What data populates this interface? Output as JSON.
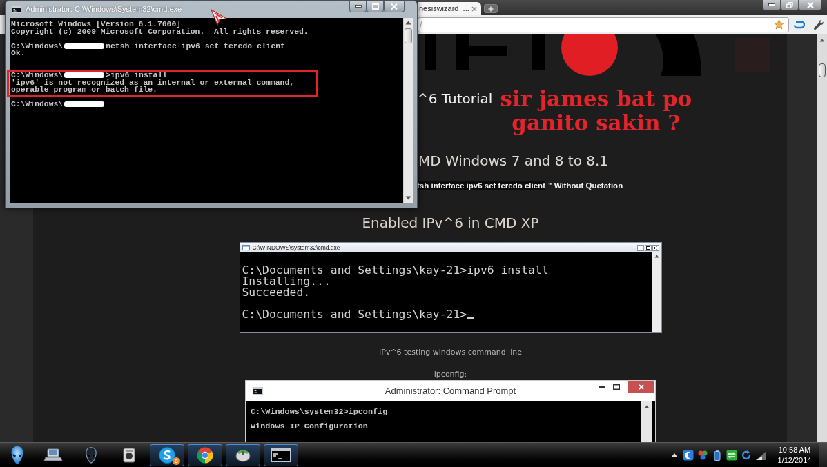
{
  "cmd_window": {
    "title": "Administrator: C:\\Windows\\System32\\cmd.exe",
    "blocks": [
      {
        "highlighted": false,
        "lines": [
          {
            "text": "Microsoft Windows [Version 6.1.7600]",
            "redacted": false
          },
          {
            "text": "Copyright (c) 2009 Microsoft Corporation.  All rights reserved.",
            "redacted": false
          }
        ]
      },
      {
        "highlighted": false,
        "lines": [
          {
            "prefix": "C:\\Windows\\",
            "redacted": true,
            "text": "netsh interface ipv6 set teredo client"
          },
          {
            "text": "Ok.",
            "redacted": false
          }
        ]
      },
      {
        "highlighted": true,
        "lines": [
          {
            "prefix": "C:\\Windows\\",
            "redacted": true,
            "text": ">ipv6 install"
          },
          {
            "text": "'ipv6' is not recognized as an internal or external command,",
            "redacted": false
          },
          {
            "text": "operable program or batch file.",
            "redacted": false
          }
        ]
      },
      {
        "highlighted": false,
        "lines": [
          {
            "prefix": "C:\\Windows\\",
            "redacted": true
          }
        ]
      }
    ]
  },
  "browser": {
    "tab": {
      "title": "nesiswizard_...",
      "selected": true
    },
    "address": "/"
  },
  "page": {
    "title_fragment": "^6 Tutorial",
    "annotation": "sir james bat po ganito sakin ?",
    "subtitle_fragment": "MD Windows 7 and 8 to 8.1",
    "instruction": {
      "command": "tsh interface ipv6 set teredo client",
      "text": "\" Without Quetation"
    },
    "xp_heading": "Enabled IPv^6 in CMD XP",
    "xp_console": {
      "title": "C:\\WINDOWS\\system32\\cmd.exe",
      "blocks": [
        [
          "C:\\Documents and Settings\\kay-21>ipv6 install",
          "Installing...",
          "Succeeded."
        ],
        [
          "C:\\Documents and Settings\\kay-21>"
        ]
      ]
    },
    "caption": "IPv^6 testing windows command line",
    "label": "ipconfig:",
    "win8_console": {
      "title": "Administrator: Command Prompt",
      "blocks": [
        [
          "C:\\Windows\\system32>ipconfig"
        ],
        [
          "Windows IP Configuration"
        ]
      ]
    }
  },
  "taskbar": {
    "apps": [
      {
        "running": false
      },
      {
        "running": false
      },
      {
        "running": false
      },
      {
        "running": true,
        "badge": "3"
      },
      {
        "running": true
      },
      {
        "running": true
      },
      {
        "running": true
      }
    ],
    "clock": {
      "time": "10:58 AM",
      "date": "1/12/2014"
    }
  }
}
